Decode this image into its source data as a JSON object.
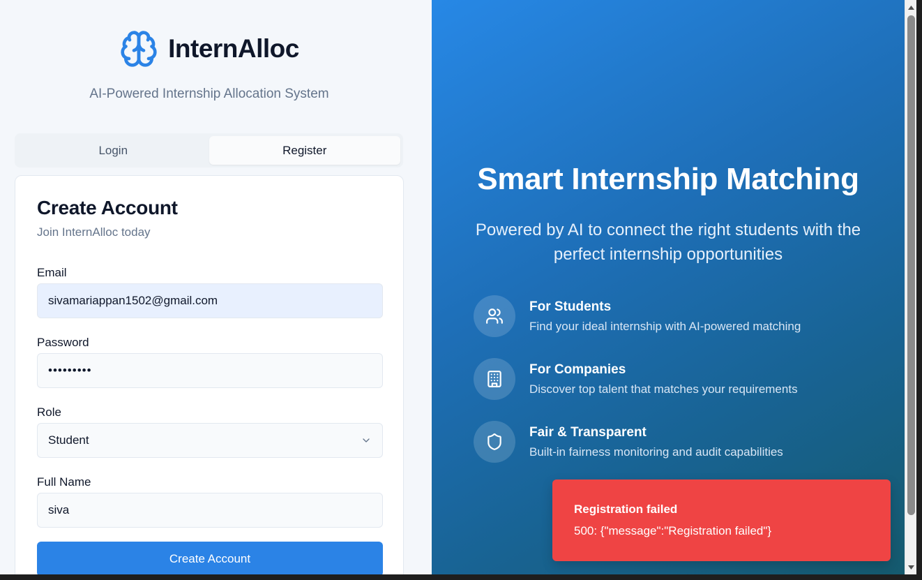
{
  "brand": {
    "name": "InternAlloc",
    "icon": "brain-icon",
    "tagline": "AI-Powered Internship Allocation System"
  },
  "tabs": [
    {
      "label": "Login",
      "active": false
    },
    {
      "label": "Register",
      "active": true
    }
  ],
  "form": {
    "title": "Create Account",
    "subtitle": "Join InternAlloc today",
    "email": {
      "label": "Email",
      "value": "sivamariappan1502@gmail.com"
    },
    "password": {
      "label": "Password",
      "value": "•••••••••"
    },
    "role": {
      "label": "Role",
      "value": "Student"
    },
    "full_name": {
      "label": "Full Name",
      "value": "siva"
    },
    "submit_label": "Create Account"
  },
  "hero": {
    "title": "Smart Internship Matching",
    "subtitle": "Powered by AI to connect the right students with the perfect internship opportunities",
    "features": [
      {
        "icon": "users-icon",
        "title": "For Students",
        "desc": "Find your ideal internship with AI-powered matching"
      },
      {
        "icon": "building-icon",
        "title": "For Companies",
        "desc": "Discover top talent that matches your requirements"
      },
      {
        "icon": "shield-icon",
        "title": "Fair & Transparent",
        "desc": "Built-in fairness monitoring and audit capabilities"
      }
    ]
  },
  "toast": {
    "title": "Registration failed",
    "message": "500: {\"message\":\"Registration failed\"}"
  },
  "colors": {
    "primary": "#2b83e6",
    "error": "#ef4444",
    "brand_icon": "#2b83e6"
  }
}
